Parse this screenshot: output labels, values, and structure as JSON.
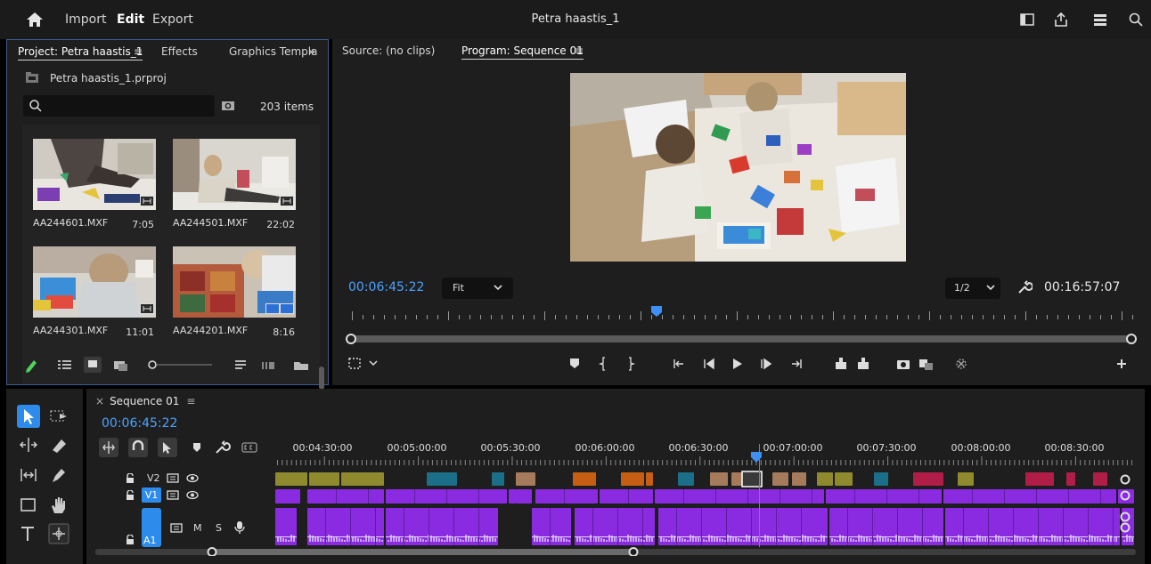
{
  "topbar": {
    "menus": [
      "Import",
      "Edit",
      "Export"
    ],
    "active_menu": "Edit",
    "title": "Petra haastis_1"
  },
  "project": {
    "tabs": {
      "project": "Project: Petra haastis_1",
      "effects": "Effects",
      "graphics": "Graphics Templa"
    },
    "file": "Petra haastis_1.prproj",
    "item_count": "203 items",
    "clips": [
      {
        "name": "AA244601.MXF",
        "length": "7:05"
      },
      {
        "name": "AA244501.MXF",
        "length": "22:02"
      },
      {
        "name": "AA244301.MXF",
        "length": "11:01"
      },
      {
        "name": "AA244201.MXF",
        "length": "8:16"
      }
    ]
  },
  "monitor": {
    "source_tab": "Source: (no clips)",
    "program_tab": "Program: Sequence 01",
    "current_tc": "00:06:45:22",
    "fit": "Fit",
    "resolution": "1/2",
    "duration_tc": "00:16:57:07"
  },
  "timeline": {
    "sequence_tab": "Sequence 01",
    "current_tc": "00:06:45:22",
    "ruler_labels": [
      "00:04:30:00",
      "00:05:00:00",
      "00:05:30:00",
      "00:06:00:00",
      "00:06:30:00",
      "00:07:00:00",
      "00:07:30:00",
      "00:08:00:00",
      "00:08:30:00"
    ],
    "tracks": {
      "v2": "V2",
      "v1": "V1",
      "a1": "A1",
      "mute": "M",
      "solo": "S"
    }
  },
  "colors": {
    "accent": "#2d8ceb",
    "video_clip": "#8a2be2",
    "audio_clip": "#8a2be2",
    "olive_clip": "#8f8a2e",
    "teal_clip": "#1b6f88",
    "tan_clip": "#a57b5c",
    "orange_clip": "#c65f13",
    "red_clip": "#b01e48"
  }
}
